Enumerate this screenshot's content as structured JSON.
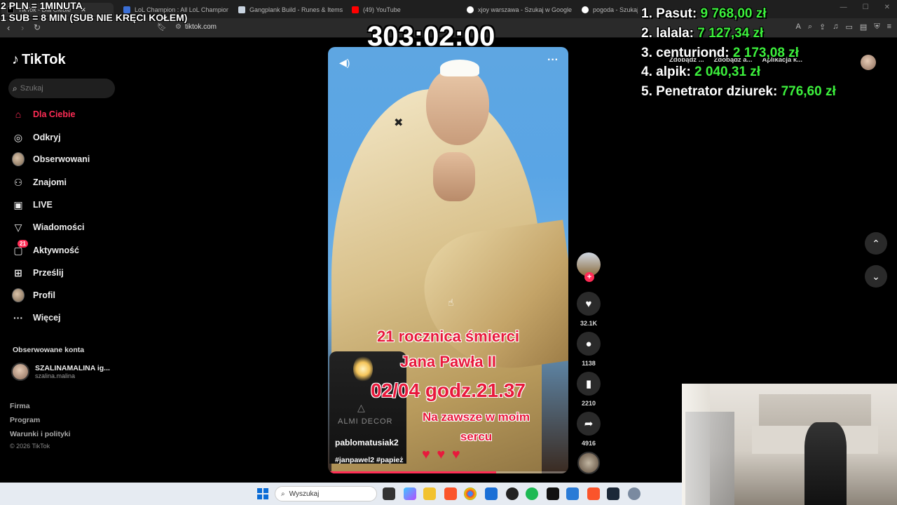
{
  "browser": {
    "tabs": [
      {
        "label": "TikTok - Dla Ciebie",
        "active": true
      },
      {
        "label": "LoL Champion : All LoL Champion Bu"
      },
      {
        "label": "Gangplank Build - Runes & Items Pat"
      },
      {
        "label": "(49) YouTube"
      },
      {
        "label": "xjoy warszawa - Szukaj w Google"
      },
      {
        "label": "pogoda - Szukaj w Google"
      }
    ],
    "url": "tiktok.com",
    "header_buttons": [
      "Zdobądź ...",
      "Zdobądź a...",
      "Aplikacja k..."
    ]
  },
  "overlay": {
    "line1": "2 PLN =  1MINUTA",
    "line2": "1 SUB = 8 MIN (SUB NIE KRĘCI KOŁEM)",
    "timer": "303:02:00"
  },
  "leaderboard": [
    {
      "rank": "1.",
      "name": "Pasut:",
      "amount": "9 768,00 zł"
    },
    {
      "rank": "2.",
      "name": "lalala:",
      "amount": "7 127,34 zł"
    },
    {
      "rank": "3.",
      "name": "centuriond:",
      "amount": "2 173,08 zł"
    },
    {
      "rank": "4.",
      "name": "alpik:",
      "amount": "2 040,31 zł"
    },
    {
      "rank": "5.",
      "name": "Penetrator dziurek:",
      "amount": "776,60 zł"
    }
  ],
  "sidebar": {
    "logo": "TikTok",
    "search_placeholder": "Szukaj",
    "items": [
      {
        "label": "Dla Ciebie",
        "icon": "home-icon",
        "active": true
      },
      {
        "label": "Odkryj",
        "icon": "compass-icon"
      },
      {
        "label": "Obserwowani",
        "icon": "avatar-icon"
      },
      {
        "label": "Znajomi",
        "icon": "friends-icon"
      },
      {
        "label": "LIVE",
        "icon": "live-icon"
      },
      {
        "label": "Wiadomości",
        "icon": "messages-icon"
      },
      {
        "label": "Aktywność",
        "icon": "activity-icon",
        "badge": "21"
      },
      {
        "label": "Prześlij",
        "icon": "upload-icon"
      },
      {
        "label": "Profil",
        "icon": "profile-icon"
      },
      {
        "label": "Więcej",
        "icon": "more-icon"
      }
    ],
    "followed_heading": "Obserwowane konta",
    "followed_account": {
      "name": "SZALINAMALINA ig...",
      "handle": "szalina.malina"
    },
    "footer": [
      "Firma",
      "Program",
      "Warunki i polityki"
    ],
    "copyright": "© 2026 TikTok"
  },
  "video": {
    "overlay_lines": [
      "21 rocznica śmierci",
      "Jana Pawła II",
      "02/04 godz.21.37",
      "Na zawsze w moim",
      "sercu"
    ],
    "candle_brand": "ALMI DECOR",
    "author": "pablomatusiak2",
    "tags": "#janpawel2 #papież",
    "progress": 0.7
  },
  "actions": {
    "likes": "32.1K",
    "comments": "1138",
    "saves": "2210",
    "shares": "4916"
  },
  "taskbar": {
    "search_placeholder": "Wyszukaj"
  },
  "colors": {
    "accent": "#fe2c55",
    "leaderboard_amount": "#3cf03c"
  }
}
